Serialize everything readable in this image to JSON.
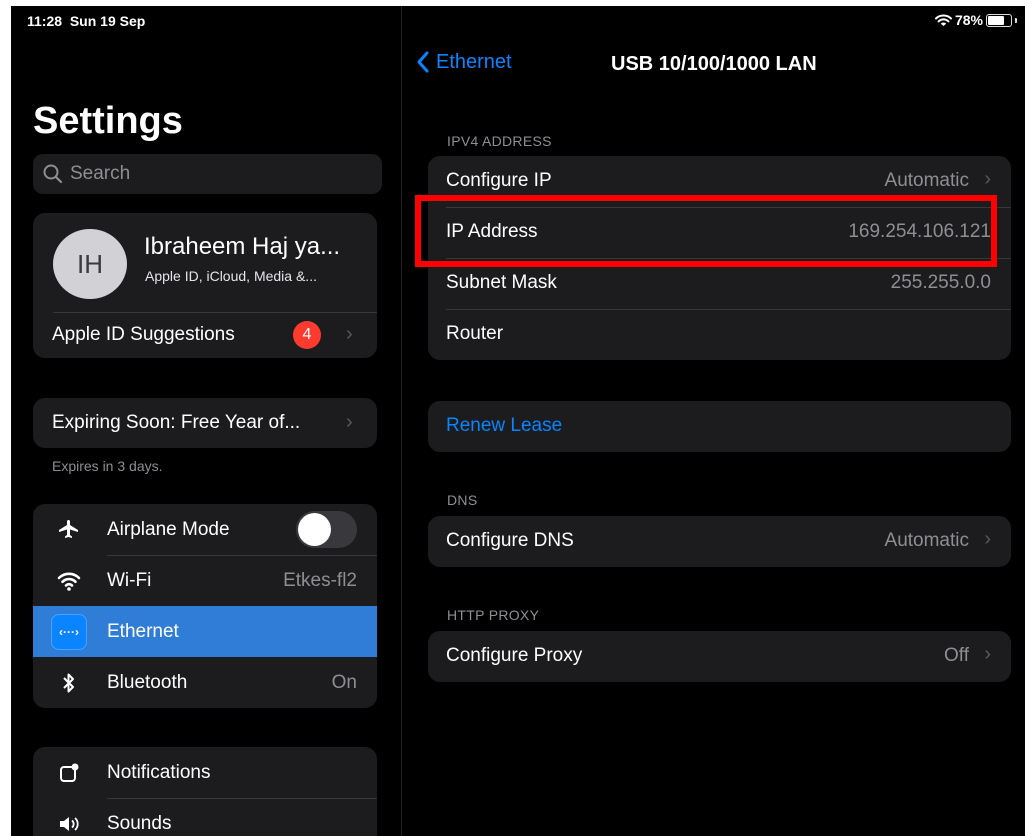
{
  "status": {
    "time": "11:28",
    "date": "Sun 19 Sep",
    "battery_percent": "78%",
    "battery_level": 0.78
  },
  "sidebar": {
    "title": "Settings",
    "search_placeholder": "Search",
    "account": {
      "initials": "IH",
      "name": "Ibraheem Haj ya...",
      "subtitle": "Apple ID, iCloud, Media &..."
    },
    "suggestions": {
      "label": "Apple ID Suggestions",
      "badge": "4"
    },
    "offer": {
      "label": "Expiring Soon: Free Year of...",
      "note": "Expires in 3 days."
    },
    "connectivity": [
      {
        "label": "Airplane Mode",
        "icon": "airplane-icon",
        "color": "#ff9500",
        "toggle": false
      },
      {
        "label": "Wi-Fi",
        "icon": "wifi-icon",
        "color": "#0a84ff",
        "value": "Etkes-fl2"
      },
      {
        "label": "Ethernet",
        "icon": "ethernet-icon",
        "color": "#0a84ff",
        "selected": true
      },
      {
        "label": "Bluetooth",
        "icon": "bluetooth-icon",
        "color": "#0a84ff",
        "value": "On"
      }
    ],
    "alerts": [
      {
        "label": "Notifications",
        "icon": "notifications-icon",
        "color": "#ff3b30"
      },
      {
        "label": "Sounds",
        "icon": "sounds-icon",
        "color": "#ff2d55"
      }
    ]
  },
  "detail": {
    "back_label": "Ethernet",
    "title": "USB 10/100/1000 LAN",
    "ipv4": {
      "header": "IPV4 ADDRESS",
      "configure_ip": {
        "label": "Configure IP",
        "value": "Automatic"
      },
      "ip_address": {
        "label": "IP Address",
        "value": "169.254.106.121"
      },
      "subnet_mask": {
        "label": "Subnet Mask",
        "value": "255.255.0.0"
      },
      "router": {
        "label": "Router",
        "value": ""
      }
    },
    "renew_lease": "Renew Lease",
    "dns": {
      "header": "DNS",
      "label": "Configure DNS",
      "value": "Automatic"
    },
    "proxy": {
      "header": "HTTP PROXY",
      "label": "Configure Proxy",
      "value": "Off"
    }
  },
  "colors": {
    "accent": "#0a84ff",
    "selected_row": "#2f7dd7",
    "highlight_box": "#ff0000",
    "badge": "#ff3b30"
  }
}
